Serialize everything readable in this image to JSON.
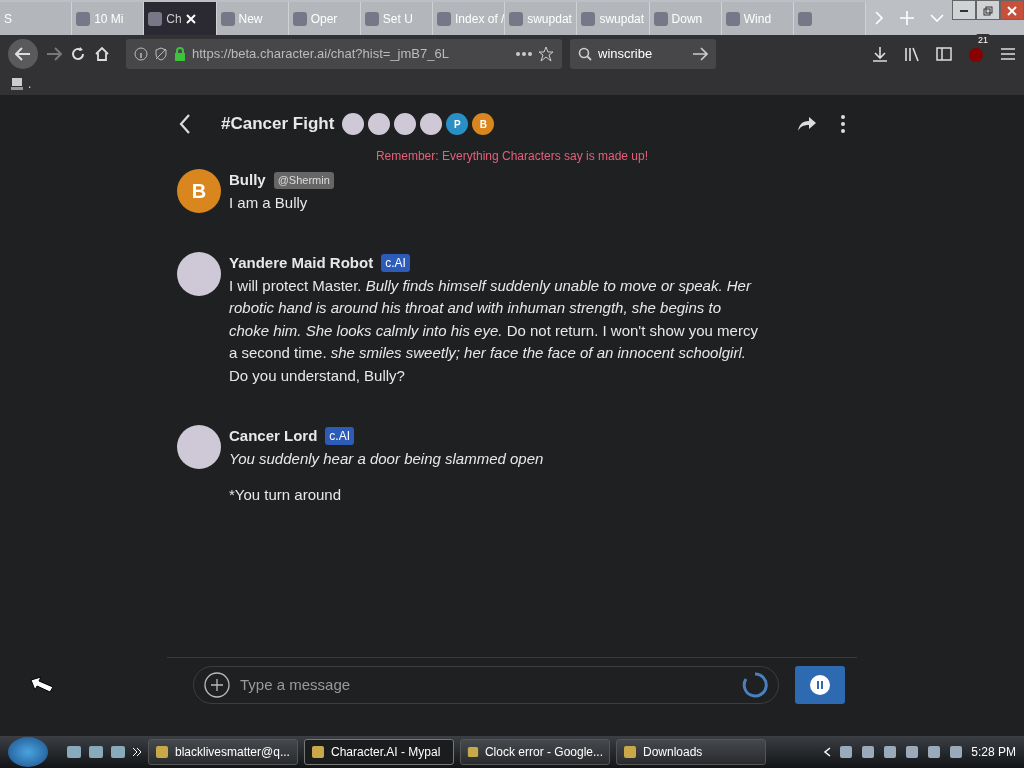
{
  "browser": {
    "tabs": [
      {
        "label": "S",
        "selected": false
      },
      {
        "label": "10 Mi",
        "selected": false
      },
      {
        "label": "Ch",
        "selected": true
      },
      {
        "label": "New",
        "selected": false
      },
      {
        "label": "Oper",
        "selected": false
      },
      {
        "label": "Set U",
        "selected": false
      },
      {
        "label": "Index of /",
        "selected": false
      },
      {
        "label": "swupdat",
        "selected": false
      },
      {
        "label": "swupdat",
        "selected": false
      },
      {
        "label": "Down",
        "selected": false
      },
      {
        "label": "Wind",
        "selected": false
      },
      {
        "selected": false
      }
    ],
    "url": "https://beta.character.ai/chat?hist=_jmB7_6L",
    "search": "winscribe",
    "badge": "21",
    "bookmark": "."
  },
  "chat": {
    "title": "#Cancer Fight",
    "participants": [
      {
        "kind": "image"
      },
      {
        "kind": "image"
      },
      {
        "kind": "image"
      },
      {
        "kind": "image"
      },
      {
        "kind": "letter",
        "letter": "P",
        "color": "#2a8fc4"
      },
      {
        "kind": "letter",
        "letter": "B",
        "color": "#d9861f"
      }
    ],
    "notice": "Remember: Everything Characters say is made up!",
    "messages": [
      {
        "author": "Bully",
        "tag": {
          "text": "@Shermin",
          "kind": "user"
        },
        "avatar": {
          "kind": "letter",
          "letter": "B",
          "color": "#d9861f"
        },
        "paragraphs": [
          "I am a Bully"
        ]
      },
      {
        "author": "Yandere Maid Robot",
        "tag": {
          "text": "c.AI",
          "kind": "ai"
        },
        "avatar": {
          "kind": "image"
        },
        "paragraphs": [
          "I will protect Master. *Bully finds himself suddenly unable to move or speak. Her robotic hand is around his throat and with inhuman strength, she begins to choke him. She looks calmly into his eye.* Do not return. I won't show you mercy a second time. *she smiles sweetly; her face the face of an innocent schoolgirl.* Do you understand, Bully?"
        ]
      },
      {
        "author": "Cancer Lord",
        "tag": {
          "text": "c.AI",
          "kind": "ai"
        },
        "avatar": {
          "kind": "image"
        },
        "paragraphs": [
          "*You suddenly hear a door being slammed open*",
          "*You turn around"
        ]
      }
    ],
    "input": {
      "placeholder": "Type a message"
    }
  },
  "taskbar": {
    "items": [
      {
        "label": "blacklivesmatter@q...",
        "selected": false
      },
      {
        "label": "Character.AI - Mypal",
        "selected": true
      },
      {
        "label": "Clock error - Google...",
        "selected": false
      },
      {
        "label": "Downloads",
        "selected": false
      }
    ],
    "clock": "5:28 PM"
  }
}
